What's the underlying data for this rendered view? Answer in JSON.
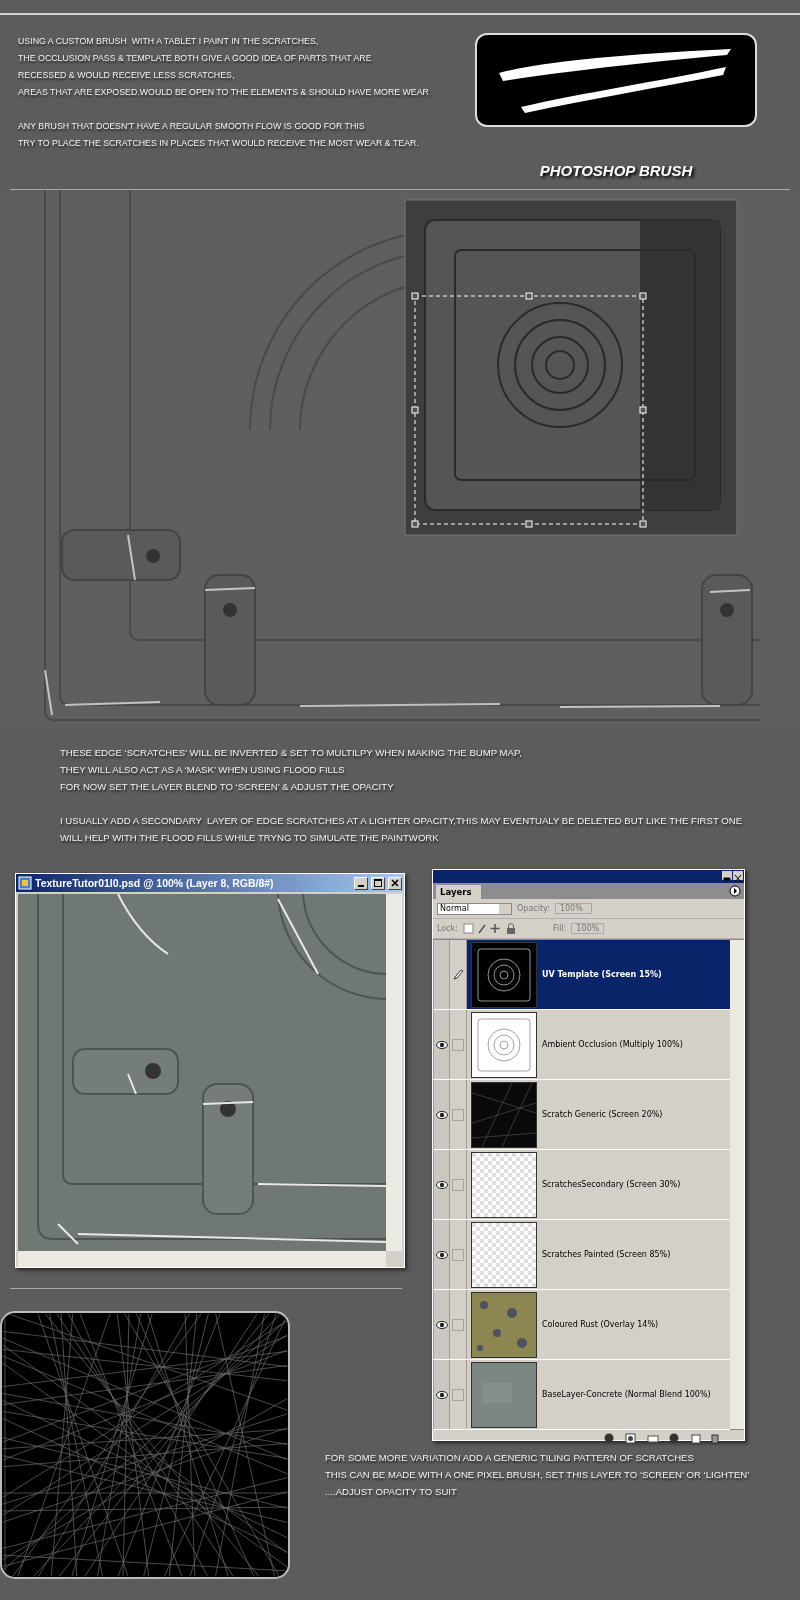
{
  "intro": {
    "paragraphs": [
      [
        "USING A CUSTOM BRUSH  WITH A TABLET I PAINT IN THE SCRATCHES,",
        "THE OCCLUSION PASS & TEMPLATE BOTH GIVE A GOOD IDEA OF PARTS THAT ARE",
        "RECESSED & WOULD RECEIVE LESS SCRATCHES,",
        "AREAS THAT ARE EXPOSED.WOULD BE OPEN TO THE ELEMENTS & SHOULD HAVE MORE WEAR"
      ],
      [
        "ANY BRUSH THAT DOESN'T HAVE A REGULAR SMOOTH FLOW IS GOOD FOR THIS",
        "TRY TO PLACE THE SCRATCHES IN PLACES THAT WOULD RECEIVE THE MOST WEAR & TEAR."
      ]
    ]
  },
  "brush_preview": {
    "caption": "PHOTOSHOP BRUSH"
  },
  "notes": {
    "paragraphs": [
      [
        "THESE EDGE ‘SCRATCHES’ WILL BE INVERTED & SET TO MULTILPY WHEN MAKING THE BUMP MAP,",
        "THEY WILL ALSO ACT AS A ‘MASK’ WHEN USING FLOOD FILLS",
        "FOR NOW SET THE LAYER BLEND TO ‘SCREEN’ & ADJUST THE OPACITY"
      ],
      [
        "I USUALLY ADD A SECONDARY  LAYER OF EDGE SCRATCHES AT A LIGHTER OPACITY,THIS MAY EVENTUALY BE DELETED BUT LIKE THE FIRST ONE",
        "WILL HELP WITH THE FLOOD FILLS WHILE TRYNG TO SIMULATE THE PAINTWORK"
      ]
    ]
  },
  "document_window": {
    "title": "TextureTutor01l0.psd @ 100% (Layer 8, RGB/8#)"
  },
  "layers_panel": {
    "tab": "Layers",
    "blend_mode": "Normal",
    "opacity_label": "Opacity:",
    "opacity": "100%",
    "lock_label": "Lock:",
    "fill_label": "Fill:",
    "fill": "100%",
    "layers": [
      {
        "name": "UV Template (Screen 15%)",
        "kind": "template-dark",
        "visible": false,
        "selected": true
      },
      {
        "name": "Ambient Occlusion (Multiply 100%)",
        "kind": "template-light",
        "visible": true,
        "selected": false
      },
      {
        "name": "Scratch Generic (Screen 20%)",
        "kind": "scratch",
        "visible": true,
        "selected": false
      },
      {
        "name": "ScratchesSecondary (Screen 30%)",
        "kind": "checker",
        "visible": true,
        "selected": false
      },
      {
        "name": "Scratches Painted (Screen 85%)",
        "kind": "checker",
        "visible": true,
        "selected": false
      },
      {
        "name": "Coloured Rust (Overlay 14%)",
        "kind": "rust",
        "visible": true,
        "selected": false
      },
      {
        "name": "BaseLayer-Concrete   (Normal Blend 100%)",
        "kind": "concrete",
        "visible": true,
        "selected": false
      }
    ]
  },
  "closing_note": {
    "lines": [
      "FOR SOME MORE VARIATION ADD A GENERIC TILING PATTERN OF SCRATCHES",
      "THIS CAN BE MADE WITH A ONE PIXEL BRUSH, SET THIS LAYER TO ‘SCREEN’ OR ‘LIGHTEN’",
      "....ADJUST OPACITY TO SUIT"
    ]
  }
}
